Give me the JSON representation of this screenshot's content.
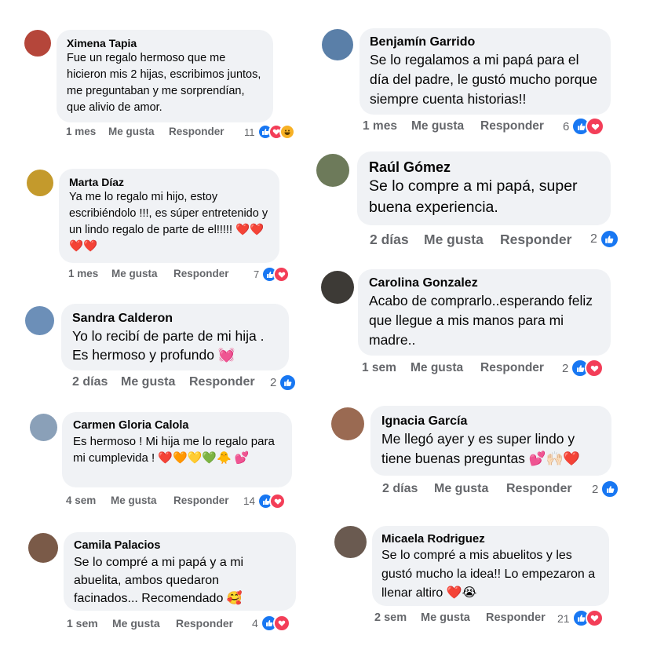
{
  "actions": {
    "like": "Me gusta",
    "reply": "Responder"
  },
  "comments": [
    {
      "author": "Ximena Tapia",
      "text": "Fue un regalo hermoso que me hicieron mis 2 hijas, escribimos juntos, me preguntaban y me sorprendían, que alivio de amor.",
      "time": "1 mes",
      "count": "11",
      "reactions": [
        "like",
        "love",
        "haha"
      ],
      "avatar_color": "#b5463a"
    },
    {
      "author": "Marta Díaz",
      "text": "Ya me lo regalo mi hijo, estoy escribiéndolo !!!, es súper entretenido y un lindo regalo de parte de el!!!!! ❤️❤️❤️❤️",
      "time": "1 mes",
      "count": "7",
      "reactions": [
        "like",
        "love"
      ],
      "avatar_color": "#c49a2c"
    },
    {
      "author": "Sandra Calderon",
      "text": "Yo lo recibí de parte de mi hija . Es hermoso y profundo 💓",
      "time": "2 días",
      "count": "2",
      "reactions": [
        "like"
      ],
      "avatar_color": "#6c8fb8"
    },
    {
      "author": "Carmen Gloria Calola",
      "text": "Es hermoso ! Mi hija me lo regalo para mi cumplevida ! ❤️🧡💛💚🐥 💕",
      "time": "4 sem",
      "count": "14",
      "reactions": [
        "like",
        "love"
      ],
      "avatar_color": "#8aa0b8"
    },
    {
      "author": "Camila Palacios",
      "text": "Se lo compré a mi papá y a mi abuelita, ambos quedaron facinados... Recomendado 🥰",
      "time": "1 sem",
      "count": "4",
      "reactions": [
        "like",
        "love"
      ],
      "avatar_color": "#7a5a48"
    },
    {
      "author": "Benjamín Garrido",
      "text": "Se lo regalamos a mi papá para el día del padre, le gustó mucho porque siempre cuenta historias!!",
      "time": "1 mes",
      "count": "6",
      "reactions": [
        "like",
        "love"
      ],
      "avatar_color": "#5a7fa8"
    },
    {
      "author": "Raúl Gómez",
      "text": "Se lo compre a mi papá, super buena experiencia.",
      "time": "2 días",
      "count": "2",
      "reactions": [
        "like"
      ],
      "avatar_color": "#6d7a5a"
    },
    {
      "author": "Carolina Gonzalez",
      "text": "Acabo de comprarlo..esperando feliz que llegue a mis manos para mi madre..",
      "time": "1 sem",
      "count": "2",
      "reactions": [
        "like",
        "love"
      ],
      "avatar_color": "#3d3a36"
    },
    {
      "author": "Ignacia García",
      "text": "Me llegó ayer y es super lindo y tiene buenas preguntas 💕🙌🏻❤️",
      "time": "2 días",
      "count": "2",
      "reactions": [
        "like"
      ],
      "avatar_color": "#9a6a52"
    },
    {
      "author": "Micaela Rodriguez",
      "text": "Se lo compré a mis abuelitos y les gustó mucho la idea!! Lo empezaron a llenar altiro ❤️😭",
      "time": "2 sem",
      "count": "21",
      "reactions": [
        "like",
        "love"
      ],
      "avatar_color": "#6a5a50"
    }
  ]
}
